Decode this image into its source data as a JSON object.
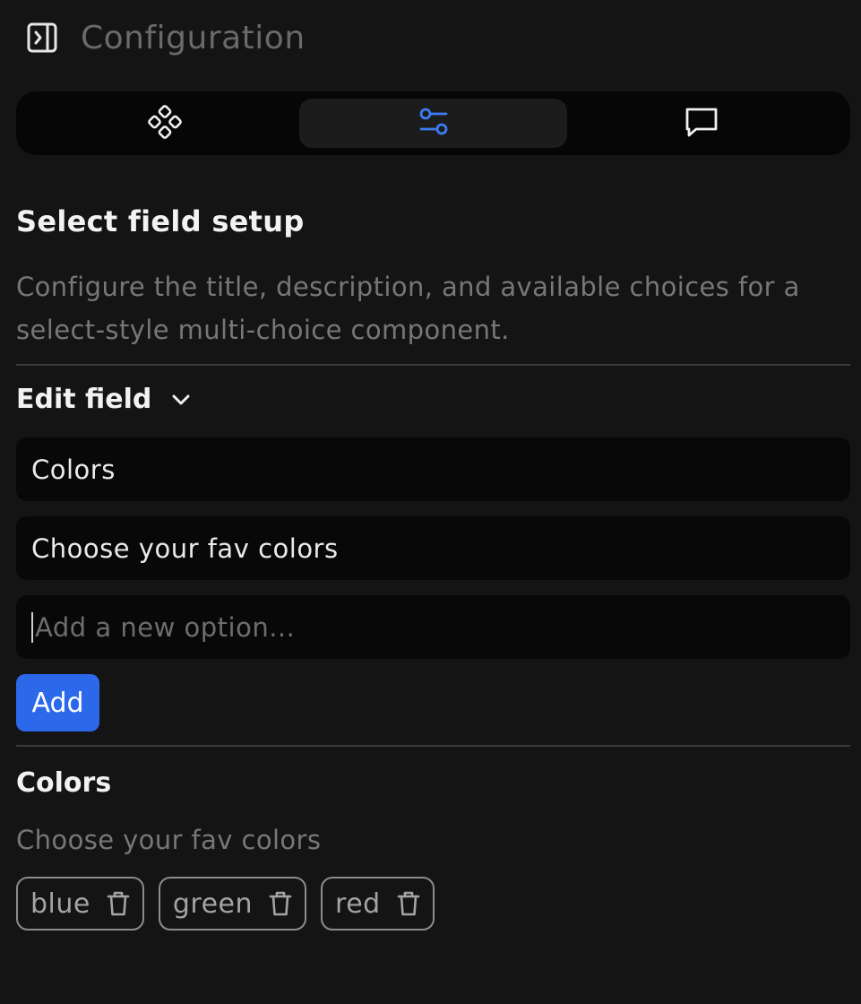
{
  "header": {
    "title": "Configuration",
    "toggle_icon": "sidebar-toggle-icon"
  },
  "tabs": [
    {
      "icon": "components-icon",
      "active": false
    },
    {
      "icon": "sliders-icon",
      "active": true
    },
    {
      "icon": "message-icon",
      "active": false
    }
  ],
  "section": {
    "title": "Select field setup",
    "description": "Configure the title, description, and available choices for a select-style multi-choice component."
  },
  "edit": {
    "label": "Edit field"
  },
  "form": {
    "title_value": "Colors",
    "description_value": "Choose your fav colors",
    "option_placeholder": "Add a new option...",
    "add_label": "Add"
  },
  "preview": {
    "title": "Colors",
    "description": "Choose your fav colors",
    "options": [
      "blue",
      "green",
      "red"
    ]
  },
  "colors": {
    "accent": "#2b69ea",
    "background": "#141414",
    "field": "#080808"
  }
}
